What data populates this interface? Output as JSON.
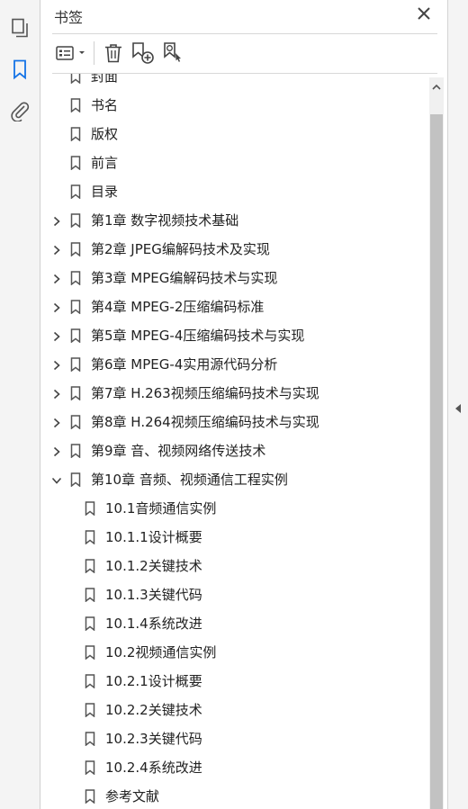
{
  "panel": {
    "title": "书签",
    "close_icon": "close-icon",
    "toolbar": {
      "options_icon": "list-options-icon",
      "delete_icon": "trash-icon",
      "new_bookmark_icon": "new-bookmark-icon",
      "bookmark_from_selection_icon": "bookmark-search-icon"
    }
  },
  "left_strip": {
    "icons": [
      "pages-icon",
      "bookmark-icon",
      "attachment-icon"
    ],
    "active": "bookmark-icon",
    "accent": "#1473e6"
  },
  "bookmarks": [
    {
      "label": "封面",
      "level": 0,
      "state": "leaf"
    },
    {
      "label": "书名",
      "level": 0,
      "state": "leaf"
    },
    {
      "label": "版权",
      "level": 0,
      "state": "leaf"
    },
    {
      "label": "前言",
      "level": 0,
      "state": "leaf"
    },
    {
      "label": "目录",
      "level": 0,
      "state": "leaf"
    },
    {
      "label": "第1章  数字视频技术基础",
      "level": 0,
      "state": "collapsed"
    },
    {
      "label": "第2章  JPEG编解码技术及实现",
      "level": 0,
      "state": "collapsed"
    },
    {
      "label": "第3章  MPEG编解码技术与实现",
      "level": 0,
      "state": "collapsed"
    },
    {
      "label": "第4章  MPEG-2压缩编码标准",
      "level": 0,
      "state": "collapsed"
    },
    {
      "label": "第5章  MPEG-4压缩编码技术与实现",
      "level": 0,
      "state": "collapsed"
    },
    {
      "label": "第6章  MPEG-4实用源代码分析",
      "level": 0,
      "state": "collapsed"
    },
    {
      "label": "第7章  H.263视频压缩编码技术与实现",
      "level": 0,
      "state": "collapsed"
    },
    {
      "label": "第8章  H.264视频压缩编码技术与实现",
      "level": 0,
      "state": "collapsed"
    },
    {
      "label": "第9章  音、视频网络传送技术",
      "level": 0,
      "state": "collapsed"
    },
    {
      "label": "第10章  音频、视频通信工程实例",
      "level": 0,
      "state": "expanded"
    },
    {
      "label": "10.1音频通信实例",
      "level": 1,
      "state": "leaf"
    },
    {
      "label": "10.1.1设计概要",
      "level": 1,
      "state": "leaf"
    },
    {
      "label": "10.1.2关键技术",
      "level": 1,
      "state": "leaf"
    },
    {
      "label": "10.1.3关键代码",
      "level": 1,
      "state": "leaf"
    },
    {
      "label": "10.1.4系统改进",
      "level": 1,
      "state": "leaf"
    },
    {
      "label": "10.2视频通信实例",
      "level": 1,
      "state": "leaf"
    },
    {
      "label": "10.2.1设计概要",
      "level": 1,
      "state": "leaf"
    },
    {
      "label": "10.2.2关键技术",
      "level": 1,
      "state": "leaf"
    },
    {
      "label": "10.2.3关键代码",
      "level": 1,
      "state": "leaf"
    },
    {
      "label": "10.2.4系统改进",
      "level": 1,
      "state": "leaf"
    },
    {
      "label": "参考文献",
      "level": 1,
      "state": "leaf"
    }
  ],
  "scrollbar": {
    "up_icon": "scroll-up-arrow-icon"
  },
  "right_strip": {
    "icon": "collapse-left-arrow-icon"
  }
}
